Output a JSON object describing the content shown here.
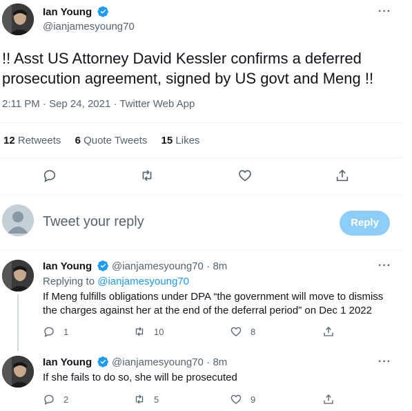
{
  "main_tweet": {
    "author_name": "Ian Young",
    "author_handle": "@ianjamesyoung70",
    "text": "!! Asst US Attorney David Kessler confirms a deferred prosecution agreement, signed by US govt and Meng !!",
    "timestamp": "2:11 PM · Sep 24, 2021 · Twitter Web App",
    "stats": {
      "retweets_count": "12",
      "retweets_label": "Retweets",
      "quotes_count": "6",
      "quotes_label": "Quote Tweets",
      "likes_count": "15",
      "likes_label": "Likes"
    }
  },
  "composer": {
    "placeholder": "Tweet your reply",
    "reply_button_label": "Reply"
  },
  "replies": [
    {
      "author_name": "Ian Young",
      "author_handle": "@ianjamesyoung70",
      "time": "· 8m",
      "replying_to_label": "Replying to",
      "replying_to_handle": "@ianjamesyoung70",
      "text_line1": "If Meng fulfills obligations under DPA “the government will move to dismiss",
      "text_line2": "the charges against her at the end of the deferral period” on Dec 1 2022",
      "reply_count": "1",
      "retweet_count": "10",
      "like_count": "8"
    },
    {
      "author_name": "Ian Young",
      "author_handle": "@ianjamesyoung70",
      "time": "· 8m",
      "text": "If she fails to do so, she will be prosecuted",
      "reply_count": "2",
      "retweet_count": "5",
      "like_count": "9"
    }
  ],
  "more_label": "···",
  "icons": {
    "verified": "verified-badge-icon",
    "reply": "reply-icon",
    "retweet": "retweet-icon",
    "like": "heart-icon",
    "share": "share-icon",
    "more": "more-icon",
    "avatar_placeholder": "user-icon"
  },
  "colors": {
    "accent": "#1d9bf0",
    "reply_button_disabled": "#8ecdf8",
    "muted_text": "#536471",
    "divider": "#eff3f4"
  }
}
